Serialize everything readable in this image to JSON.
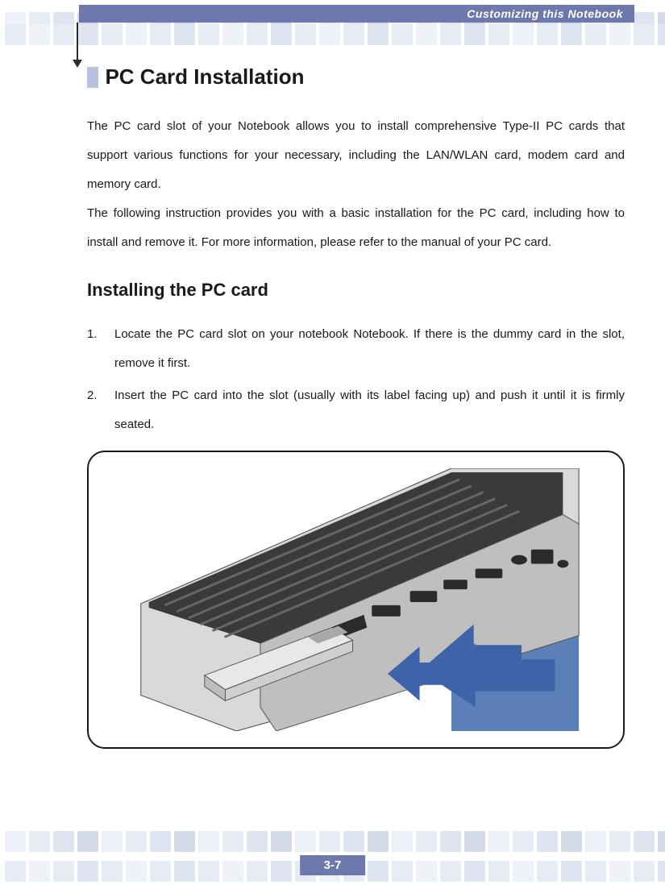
{
  "header": {
    "breadcrumb": "Customizing this Notebook"
  },
  "section": {
    "title": "PC Card Installation",
    "intro_p1": "The PC card slot of your Notebook allows you to install comprehensive Type-II PC cards that support various functions for your necessary, including the LAN/WLAN card, modem card and memory card.",
    "intro_p2": "The following instruction provides you with a basic installation for the PC card, including how to install and remove it.   For more information, please refer to the manual of your PC card.",
    "subhead": "Installing the PC card",
    "steps": [
      "Locate the PC card slot on your notebook Notebook.   If there is the dummy card in the slot, remove it first.",
      "Insert the PC card into the slot (usually with its label facing up) and push it until it is firmly seated."
    ]
  },
  "figure": {
    "caption_alt": "Notebook side view with PC card being inserted into slot, arrow indicating insertion direction"
  },
  "footer": {
    "page": "3-7"
  }
}
